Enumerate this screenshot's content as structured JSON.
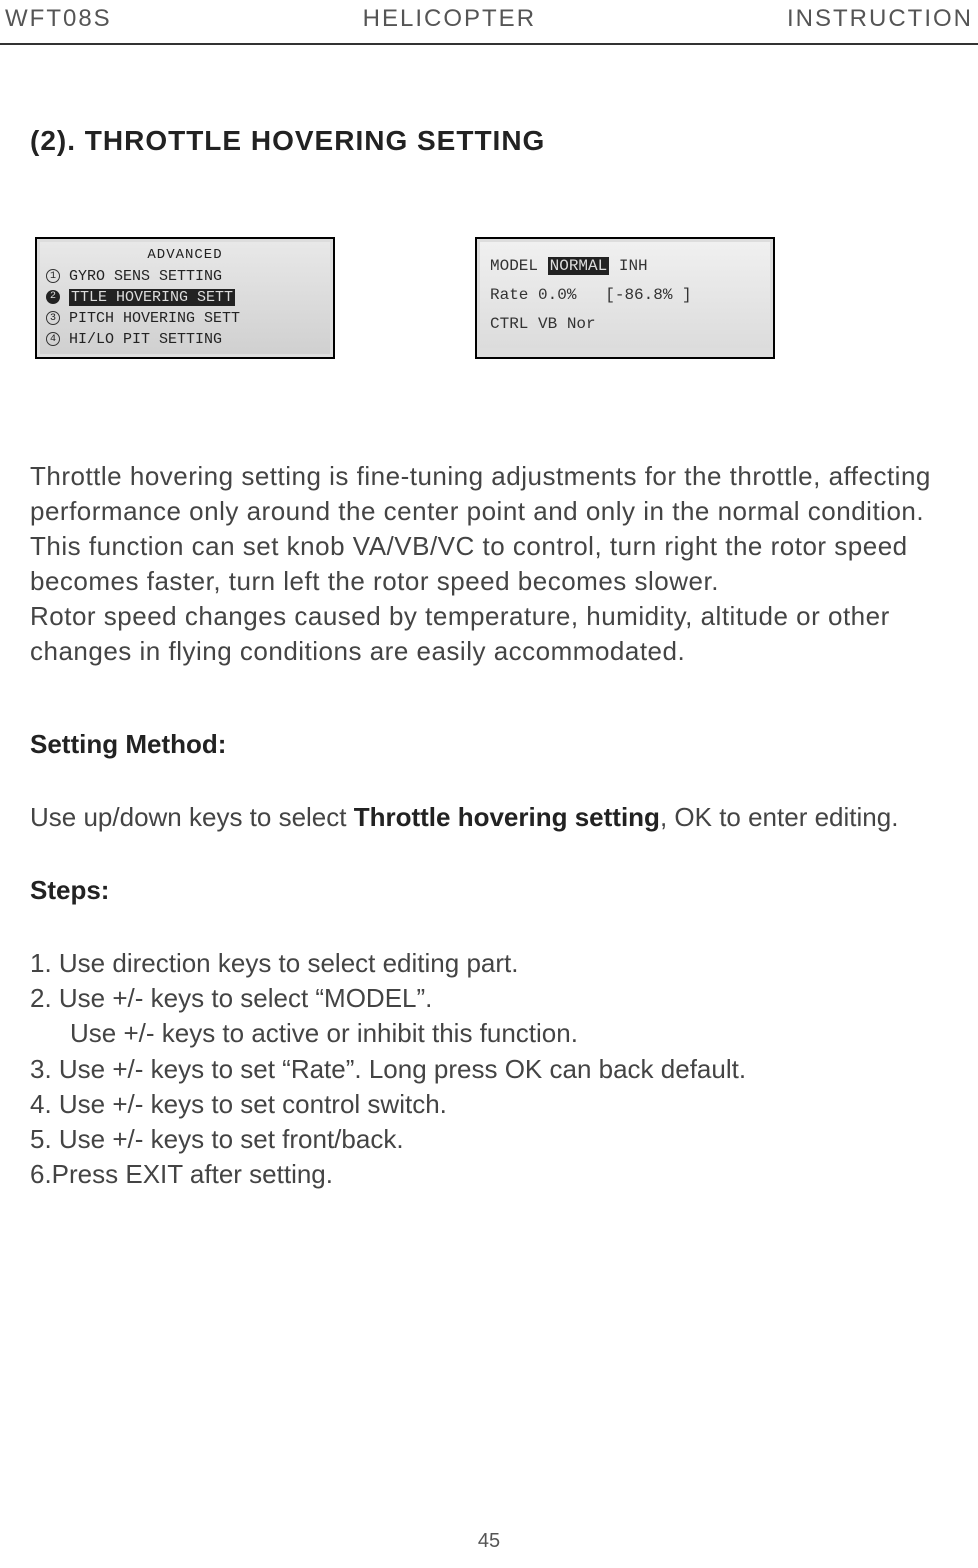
{
  "header": {
    "left": "WFT08S",
    "center": "HELICOPTER",
    "right": "INSTRUCTION"
  },
  "section_title": "(2). THROTTLE HOVERING SETTING",
  "lcd1": {
    "title": "ADVANCED",
    "row1_num": "1",
    "row1_text": "GYRO SENS SETTING",
    "row2_num": "2",
    "row2_text": "TTLE HOVERING SETT",
    "row3_num": "3",
    "row3_text": "PITCH HOVERING SETT",
    "row4_num": "4",
    "row4_text": "HI/LO PIT SETTING"
  },
  "lcd2": {
    "model_label": "MODEL",
    "model_value": "NORMAL",
    "model_state": "INH",
    "rate_label": "Rate",
    "rate_value": "0.0%",
    "rate_bracket": "[-86.8% ]",
    "ctrl_label": "CTRL",
    "ctrl_value": "VB Nor"
  },
  "body_p1": "Throttle hovering setting is fine-tuning adjustments for the throttle, affecting performance only around the center point and only in the normal condition. This function can set knob VA/VB/VC to control, turn right the rotor speed becomes faster, turn left the rotor speed becomes slower.",
  "body_p2": "Rotor speed changes caused by temperature, humidity, altitude or other changes in flying conditions are easily accommodated.",
  "setting_method_label": "Setting Method:",
  "method_intro_pre": "Use up/down keys to select ",
  "method_intro_bold": "Throttle hovering setting",
  "method_intro_post": ", OK to enter editing.",
  "steps_label": "Steps:",
  "steps": {
    "s1": "1. Use direction keys to select editing part.",
    "s2": "2. Use +/- keys to select “MODEL”.",
    "s2b": "Use +/- keys to active or inhibit this function.",
    "s3": "3. Use +/- keys to set “Rate”. Long press OK can back default.",
    "s4": "4. Use +/- keys to set control switch.",
    "s5": "5. Use +/- keys to set  front/back.",
    "s6": "6.Press EXIT after setting."
  },
  "page_number": "45"
}
